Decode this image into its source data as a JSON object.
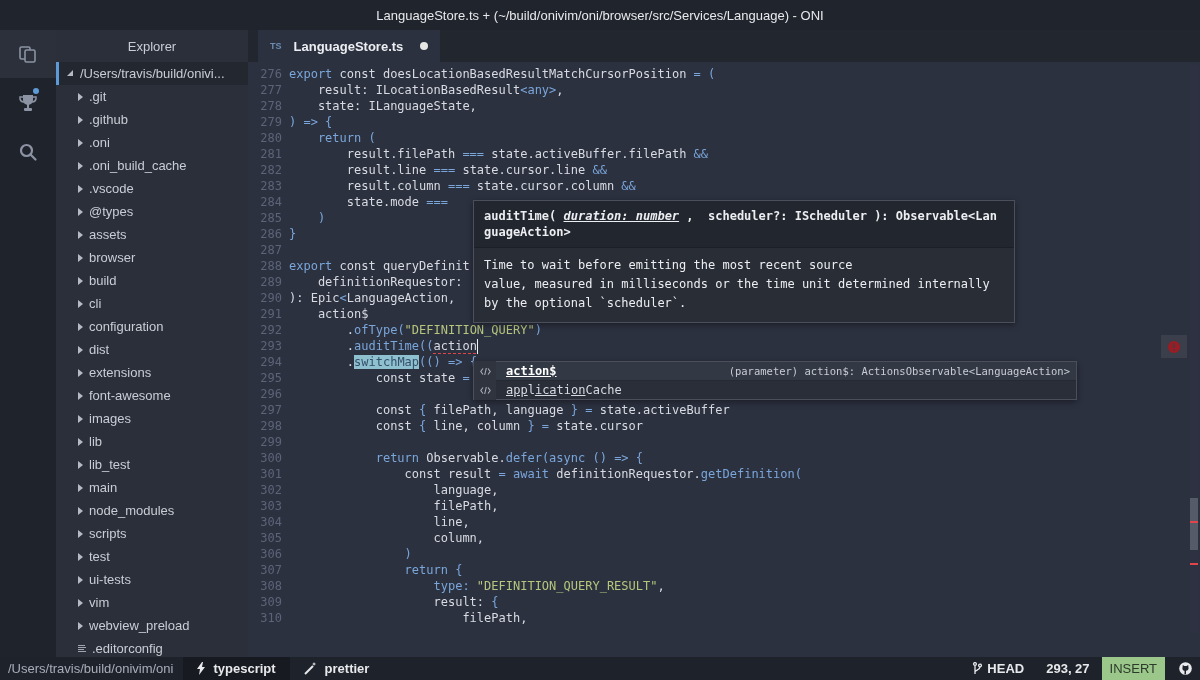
{
  "window": {
    "title": "LanguageStore.ts + (~/build/onivim/oni/browser/src/Services/Language) - ONI"
  },
  "activity_bar": {
    "items": [
      {
        "kind": "files",
        "selected": true
      },
      {
        "kind": "trophy",
        "selected": false,
        "badge": true
      },
      {
        "kind": "search",
        "selected": false
      }
    ]
  },
  "explorer": {
    "title": "Explorer",
    "tree": [
      {
        "label": "/Users/travis/build/onivi...",
        "kind": "folder",
        "expanded": true,
        "selected": true,
        "children": [
          {
            "label": ".git",
            "kind": "folder",
            "expanded": false,
            "selected": false
          },
          {
            "label": ".github",
            "kind": "folder",
            "expanded": false,
            "selected": false
          },
          {
            "label": ".oni",
            "kind": "folder",
            "expanded": false,
            "selected": false
          },
          {
            "label": ".oni_build_cache",
            "kind": "folder",
            "expanded": false,
            "selected": false
          },
          {
            "label": ".vscode",
            "kind": "folder",
            "expanded": false,
            "selected": false
          },
          {
            "label": "@types",
            "kind": "folder",
            "expanded": false,
            "selected": false
          },
          {
            "label": "assets",
            "kind": "folder",
            "expanded": false,
            "selected": false
          },
          {
            "label": "browser",
            "kind": "folder",
            "expanded": false,
            "selected": false
          },
          {
            "label": "build",
            "kind": "folder",
            "expanded": false,
            "selected": false
          },
          {
            "label": "cli",
            "kind": "folder",
            "expanded": false,
            "selected": false
          },
          {
            "label": "configuration",
            "kind": "folder",
            "expanded": false,
            "selected": false
          },
          {
            "label": "dist",
            "kind": "folder",
            "expanded": false,
            "selected": false
          },
          {
            "label": "extensions",
            "kind": "folder",
            "expanded": false,
            "selected": false
          },
          {
            "label": "font-awesome",
            "kind": "folder",
            "expanded": false,
            "selected": false
          },
          {
            "label": "images",
            "kind": "folder",
            "expanded": false,
            "selected": false
          },
          {
            "label": "lib",
            "kind": "folder",
            "expanded": false,
            "selected": false
          },
          {
            "label": "lib_test",
            "kind": "folder",
            "expanded": false,
            "selected": false
          },
          {
            "label": "main",
            "kind": "folder",
            "expanded": false,
            "selected": false
          },
          {
            "label": "node_modules",
            "kind": "folder",
            "expanded": false,
            "selected": false
          },
          {
            "label": "scripts",
            "kind": "folder",
            "expanded": false,
            "selected": false
          },
          {
            "label": "test",
            "kind": "folder",
            "expanded": false,
            "selected": false
          },
          {
            "label": "ui-tests",
            "kind": "folder",
            "expanded": false,
            "selected": false
          },
          {
            "label": "vim",
            "kind": "folder",
            "expanded": false,
            "selected": false
          },
          {
            "label": "webview_preload",
            "kind": "folder",
            "expanded": false,
            "selected": false
          },
          {
            "label": ".editorconfig",
            "kind": "file",
            "selected": false
          }
        ]
      }
    ]
  },
  "editor": {
    "tabs": [
      {
        "icon_text": "TS",
        "label": "LanguageStore.ts",
        "selected": true,
        "modified": true
      }
    ],
    "lines": [
      {
        "number": "276",
        "tokens": [
          {
            "text": "export ",
            "kind": "accent"
          },
          {
            "text": "const doesLocationBasedResultMatchCursorPosition ",
            "kind": "plain"
          },
          {
            "text": "= (",
            "kind": "accent"
          }
        ]
      },
      {
        "number": "277",
        "tokens": [
          {
            "text": "    result: ILocationBasedResult",
            "kind": "plain"
          },
          {
            "text": "<any>",
            "kind": "accent"
          },
          {
            "text": ",",
            "kind": "plain"
          }
        ]
      },
      {
        "number": "278",
        "tokens": [
          {
            "text": "    state: ILanguageState,",
            "kind": "plain"
          }
        ]
      },
      {
        "number": "279",
        "tokens": [
          {
            "text": ") => {",
            "kind": "accent"
          }
        ]
      },
      {
        "number": "280",
        "tokens": [
          {
            "text": "    return (",
            "kind": "accent"
          }
        ]
      },
      {
        "number": "281",
        "tokens": [
          {
            "text": "        result.filePath ",
            "kind": "plain"
          },
          {
            "text": "=== ",
            "kind": "accent"
          },
          {
            "text": "state.activeBuffer.filePath ",
            "kind": "plain"
          },
          {
            "text": "&&",
            "kind": "accent"
          }
        ]
      },
      {
        "number": "282",
        "tokens": [
          {
            "text": "        result.line ",
            "kind": "plain"
          },
          {
            "text": "=== ",
            "kind": "accent"
          },
          {
            "text": "state.cursor.line ",
            "kind": "plain"
          },
          {
            "text": "&&",
            "kind": "accent"
          }
        ]
      },
      {
        "number": "283",
        "tokens": [
          {
            "text": "        result.column ",
            "kind": "plain"
          },
          {
            "text": "=== ",
            "kind": "accent"
          },
          {
            "text": "state.cursor.column ",
            "kind": "plain"
          },
          {
            "text": "&&",
            "kind": "accent"
          }
        ]
      },
      {
        "number": "284",
        "tokens": [
          {
            "text": "        state.mode ",
            "kind": "plain"
          },
          {
            "text": "===",
            "kind": "accent"
          }
        ]
      },
      {
        "number": "285",
        "tokens": [
          {
            "text": "    )",
            "kind": "accent"
          }
        ]
      },
      {
        "number": "286",
        "tokens": [
          {
            "text": "}",
            "kind": "accent"
          }
        ]
      },
      {
        "number": "287"
      },
      {
        "number": "288",
        "tokens": [
          {
            "text": "export ",
            "kind": "accent"
          },
          {
            "text": "const queryDefinit",
            "kind": "plain"
          }
        ]
      },
      {
        "number": "289",
        "tokens": [
          {
            "text": "    definitionRequestor:",
            "kind": "plain"
          }
        ]
      },
      {
        "number": "290",
        "tokens": [
          {
            "text": "): Epic",
            "kind": "plain"
          },
          {
            "text": "<",
            "kind": "accent"
          },
          {
            "text": "LanguageAction,",
            "kind": "plain"
          }
        ]
      },
      {
        "number": "291",
        "tokens": [
          {
            "text": "    action$",
            "kind": "plain"
          }
        ]
      },
      {
        "number": "292",
        "tokens": [
          {
            "text": "        .",
            "kind": "plain"
          },
          {
            "text": "ofType(",
            "kind": "accent"
          },
          {
            "text": "\"DEFINITION_QUERY\"",
            "kind": "string"
          },
          {
            "text": ")",
            "kind": "accent"
          }
        ]
      },
      {
        "number": "293",
        "cursor": true,
        "tokens": [
          {
            "text": "        .",
            "kind": "plain"
          },
          {
            "text": "auditTime((",
            "kind": "accent"
          },
          {
            "text": "action",
            "kind": "error"
          }
        ]
      },
      {
        "number": "294",
        "tokens": [
          {
            "text": "        .",
            "kind": "plain"
          },
          {
            "text": "switchMap",
            "kind": "highlight"
          },
          {
            "text": "(() => {",
            "kind": "accent"
          }
        ]
      },
      {
        "number": "295",
        "tokens": [
          {
            "text": "            const state ",
            "kind": "plain"
          },
          {
            "text": "=",
            "kind": "accent"
          }
        ]
      },
      {
        "number": "296"
      },
      {
        "number": "297",
        "tokens": [
          {
            "text": "            const ",
            "kind": "plain"
          },
          {
            "text": "{ ",
            "kind": "accent"
          },
          {
            "text": "filePath, language ",
            "kind": "plain"
          },
          {
            "text": "} = ",
            "kind": "accent"
          },
          {
            "text": "state.activeBuffer",
            "kind": "plain"
          }
        ]
      },
      {
        "number": "298",
        "tokens": [
          {
            "text": "            const ",
            "kind": "plain"
          },
          {
            "text": "{ ",
            "kind": "accent"
          },
          {
            "text": "line, column ",
            "kind": "plain"
          },
          {
            "text": "} = ",
            "kind": "accent"
          },
          {
            "text": "state.cursor",
            "kind": "plain"
          }
        ]
      },
      {
        "number": "299"
      },
      {
        "number": "300",
        "tokens": [
          {
            "text": "            return ",
            "kind": "accent"
          },
          {
            "text": "Observable.",
            "kind": "plain"
          },
          {
            "text": "defer(async () => {",
            "kind": "accent"
          }
        ]
      },
      {
        "number": "301",
        "tokens": [
          {
            "text": "                const result ",
            "kind": "plain"
          },
          {
            "text": "= await ",
            "kind": "accent"
          },
          {
            "text": "definitionRequestor.",
            "kind": "plain"
          },
          {
            "text": "getDefinition(",
            "kind": "accent"
          }
        ]
      },
      {
        "number": "302",
        "tokens": [
          {
            "text": "                    language,",
            "kind": "plain"
          }
        ]
      },
      {
        "number": "303",
        "tokens": [
          {
            "text": "                    filePath,",
            "kind": "plain"
          }
        ]
      },
      {
        "number": "304",
        "tokens": [
          {
            "text": "                    line,",
            "kind": "plain"
          }
        ]
      },
      {
        "number": "305",
        "tokens": [
          {
            "text": "                    column,",
            "kind": "plain"
          }
        ]
      },
      {
        "number": "306",
        "tokens": [
          {
            "text": "                )",
            "kind": "accent"
          }
        ]
      },
      {
        "number": "307",
        "tokens": [
          {
            "text": "                return {",
            "kind": "accent"
          }
        ]
      },
      {
        "number": "308",
        "tokens": [
          {
            "text": "                    type: ",
            "kind": "accent"
          },
          {
            "text": "\"DEFINITION_QUERY_RESULT\"",
            "kind": "string"
          },
          {
            "text": ",",
            "kind": "plain"
          }
        ]
      },
      {
        "number": "309",
        "tokens": [
          {
            "text": "                    result: ",
            "kind": "plain"
          },
          {
            "text": "{",
            "kind": "accent"
          }
        ]
      },
      {
        "number": "310",
        "tokens": [
          {
            "text": "                        filePath,",
            "kind": "plain"
          }
        ]
      }
    ],
    "signature_help": {
      "before": "auditTime( ",
      "parameter": "duration: number",
      "after": " ,  scheduler?: IScheduler ): Observable<LanguageAction>",
      "description_lines": [
        "Time to wait before emitting the most recent source",
        "value, measured in milliseconds or the time unit determined internally",
        "by the optional `scheduler`."
      ]
    },
    "completions": [
      {
        "segments": [
          {
            "text": "action$",
            "match": true
          }
        ],
        "detail": "(parameter) action$: ActionsObservable<LanguageAction>",
        "selected": true
      },
      {
        "segments": [
          {
            "text": "app",
            "match": true
          },
          {
            "text": "l",
            "match": false
          },
          {
            "text": "ica",
            "match": true
          },
          {
            "text": "ti",
            "match": false
          },
          {
            "text": "on",
            "match": true
          },
          {
            "text": "Cache",
            "match": false
          }
        ],
        "selected": false
      }
    ],
    "error_marker": true
  },
  "status_bar": {
    "path": "/Users/travis/build/onivim/oni",
    "items": [
      {
        "kind": "language",
        "label": "typescript"
      },
      {
        "kind": "formatter",
        "label": "prettier"
      }
    ],
    "branch": "HEAD",
    "position": "293, 27",
    "mode": "INSERT"
  }
}
